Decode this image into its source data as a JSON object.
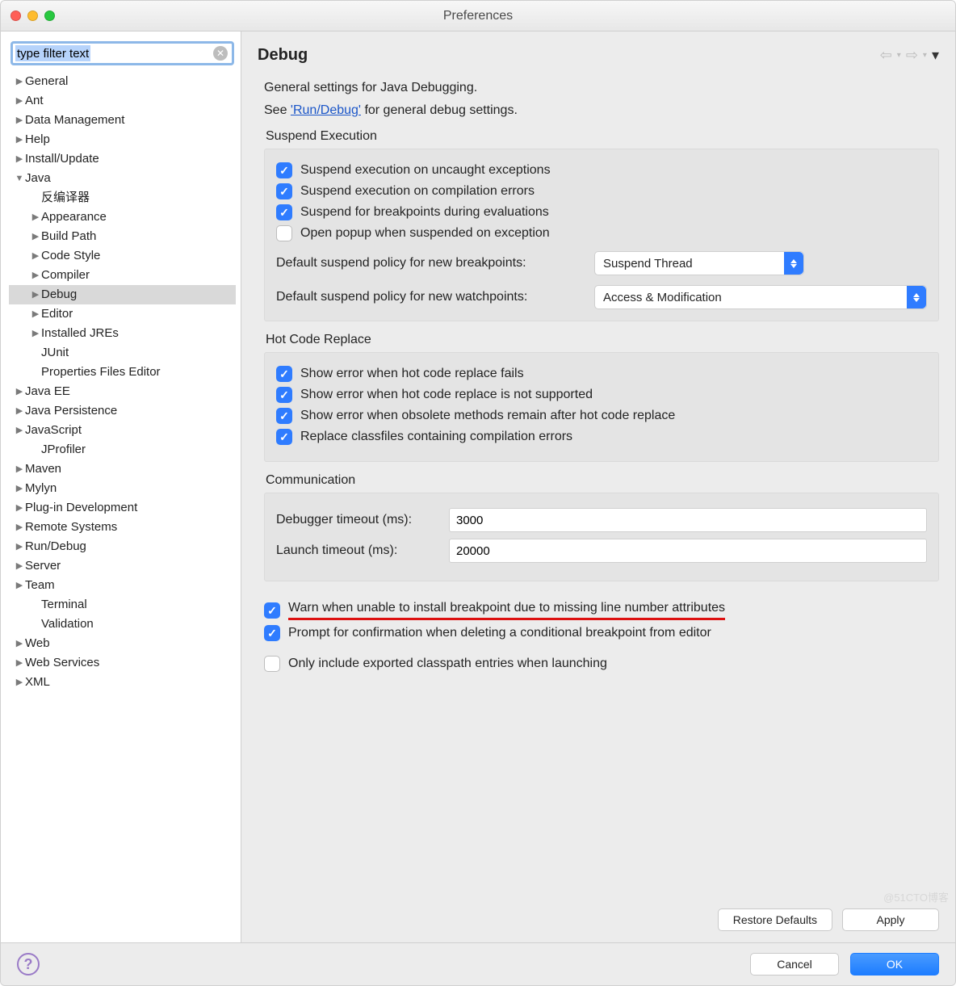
{
  "window": {
    "title": "Preferences"
  },
  "filter": {
    "value": "type filter text"
  },
  "tree": [
    {
      "label": "General",
      "level": 0,
      "arrow": "right"
    },
    {
      "label": "Ant",
      "level": 0,
      "arrow": "right"
    },
    {
      "label": "Data Management",
      "level": 0,
      "arrow": "right"
    },
    {
      "label": "Help",
      "level": 0,
      "arrow": "right"
    },
    {
      "label": "Install/Update",
      "level": 0,
      "arrow": "right"
    },
    {
      "label": "Java",
      "level": 0,
      "arrow": "down"
    },
    {
      "label": "反编译器",
      "level": 1,
      "arrow": ""
    },
    {
      "label": "Appearance",
      "level": 1,
      "arrow": "right"
    },
    {
      "label": "Build Path",
      "level": 1,
      "arrow": "right"
    },
    {
      "label": "Code Style",
      "level": 1,
      "arrow": "right"
    },
    {
      "label": "Compiler",
      "level": 1,
      "arrow": "right"
    },
    {
      "label": "Debug",
      "level": 1,
      "arrow": "right",
      "selected": true
    },
    {
      "label": "Editor",
      "level": 1,
      "arrow": "right"
    },
    {
      "label": "Installed JREs",
      "level": 1,
      "arrow": "right"
    },
    {
      "label": "JUnit",
      "level": 1,
      "arrow": ""
    },
    {
      "label": "Properties Files Editor",
      "level": 1,
      "arrow": ""
    },
    {
      "label": "Java EE",
      "level": 0,
      "arrow": "right"
    },
    {
      "label": "Java Persistence",
      "level": 0,
      "arrow": "right"
    },
    {
      "label": "JavaScript",
      "level": 0,
      "arrow": "right"
    },
    {
      "label": "JProfiler",
      "level": 1,
      "arrow": ""
    },
    {
      "label": "Maven",
      "level": 0,
      "arrow": "right"
    },
    {
      "label": "Mylyn",
      "level": 0,
      "arrow": "right"
    },
    {
      "label": "Plug-in Development",
      "level": 0,
      "arrow": "right"
    },
    {
      "label": "Remote Systems",
      "level": 0,
      "arrow": "right"
    },
    {
      "label": "Run/Debug",
      "level": 0,
      "arrow": "right"
    },
    {
      "label": "Server",
      "level": 0,
      "arrow": "right"
    },
    {
      "label": "Team",
      "level": 0,
      "arrow": "right"
    },
    {
      "label": "Terminal",
      "level": 1,
      "arrow": ""
    },
    {
      "label": "Validation",
      "level": 1,
      "arrow": ""
    },
    {
      "label": "Web",
      "level": 0,
      "arrow": "right"
    },
    {
      "label": "Web Services",
      "level": 0,
      "arrow": "right"
    },
    {
      "label": "XML",
      "level": 0,
      "arrow": "right"
    }
  ],
  "page": {
    "title": "Debug",
    "intro1": "General settings for Java Debugging.",
    "intro2_prefix": "See ",
    "intro2_link": "'Run/Debug'",
    "intro2_suffix": " for general debug settings.",
    "suspend": {
      "title": "Suspend Execution",
      "c1": {
        "label": "Suspend execution on uncaught exceptions",
        "checked": true
      },
      "c2": {
        "label": "Suspend execution on compilation errors",
        "checked": true
      },
      "c3": {
        "label": "Suspend for breakpoints during evaluations",
        "checked": true
      },
      "c4": {
        "label": "Open popup when suspended on exception",
        "checked": false
      },
      "bpPolicyLabel": "Default suspend policy for new breakpoints:",
      "bpPolicyValue": "Suspend Thread",
      "wpPolicyLabel": "Default suspend policy for new watchpoints:",
      "wpPolicyValue": "Access & Modification"
    },
    "hcr": {
      "title": "Hot Code Replace",
      "c1": {
        "label": "Show error when hot code replace fails",
        "checked": true
      },
      "c2": {
        "label": "Show error when hot code replace is not supported",
        "checked": true
      },
      "c3": {
        "label": "Show error when obsolete methods remain after hot code replace",
        "checked": true
      },
      "c4": {
        "label": "Replace classfiles containing compilation errors",
        "checked": true
      }
    },
    "comm": {
      "title": "Communication",
      "debuggerTimeoutLabel": "Debugger timeout (ms):",
      "debuggerTimeoutValue": "3000",
      "launchTimeoutLabel": "Launch timeout (ms):",
      "launchTimeoutValue": "20000"
    },
    "warn": {
      "label": "Warn when unable to install breakpoint due to missing line number attributes",
      "checked": true
    },
    "prompt": {
      "label": "Prompt for confirmation when deleting a conditional breakpoint from editor",
      "checked": true
    },
    "only": {
      "label": "Only include exported classpath entries when launching",
      "checked": false
    }
  },
  "buttons": {
    "restore": "Restore Defaults",
    "apply": "Apply",
    "cancel": "Cancel",
    "ok": "OK"
  },
  "watermark": "@51CTO博客"
}
